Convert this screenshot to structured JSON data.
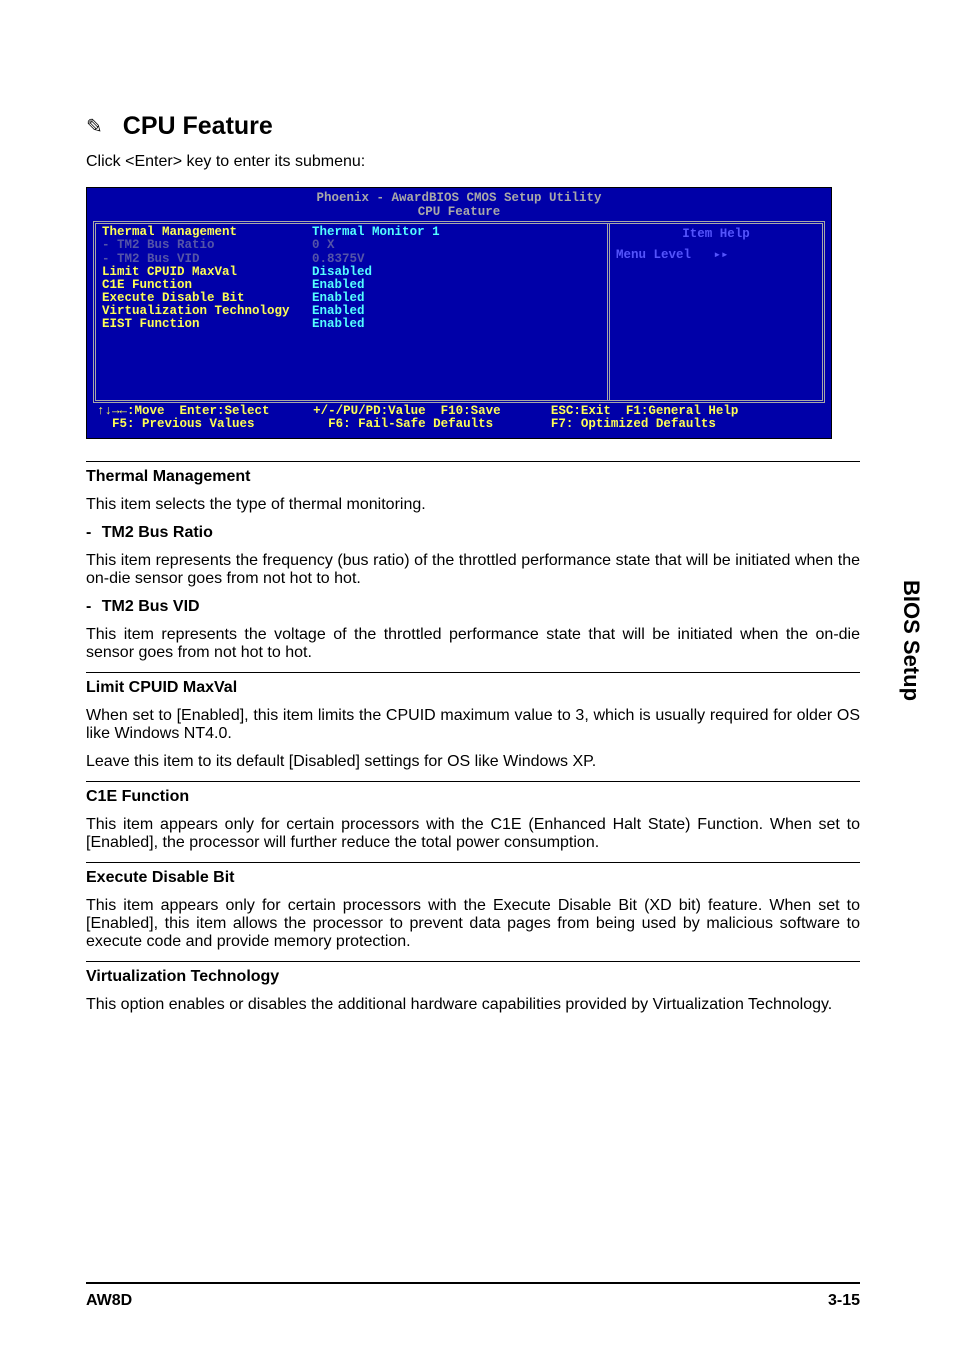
{
  "side_tab": "BIOS Setup",
  "heading": {
    "icon": "✎",
    "text": "CPU Feature"
  },
  "intro": "Click <Enter> key to enter its submenu:",
  "bios": {
    "title": "Phoenix - AwardBIOS CMOS Setup Utility",
    "subtitle": "CPU Feature",
    "rows": [
      {
        "label": "Thermal Management",
        "value": "Thermal Monitor 1",
        "dim": false
      },
      {
        "label": "- TM2 Bus Ratio",
        "value": "0 X",
        "dim": true
      },
      {
        "label": "- TM2 Bus VID",
        "value": "0.8375V",
        "dim": true
      },
      {
        "label": "Limit CPUID MaxVal",
        "value": "Disabled",
        "dim": false
      },
      {
        "label": "C1E Function",
        "value": "Enabled",
        "dim": false
      },
      {
        "label": "Execute Disable Bit",
        "value": "Enabled",
        "dim": false
      },
      {
        "label": "Virtualization Technology",
        "value": "Enabled",
        "dim": false
      },
      {
        "label": "EIST Function",
        "value": "Enabled",
        "dim": false
      }
    ],
    "help_title": "Item Help",
    "menu_level_label": "Menu Level",
    "menu_level_arrows": "▸▸",
    "footer": {
      "col1_line1": "↑↓→←:Move  Enter:Select",
      "col1_line2": "  F5: Previous Values",
      "col2_line1": "+/-/PU/PD:Value  F10:Save",
      "col2_line2": "  F6: Fail-Safe Defaults",
      "col3_line1": "ESC:Exit  F1:General Help",
      "col3_line2": "F7: Optimized Defaults"
    }
  },
  "sections": [
    {
      "title": "Thermal Management",
      "paragraphs": [
        "This item selects the type of thermal monitoring."
      ],
      "subs": [
        {
          "prefix": "-",
          "title": "TM2 Bus Ratio",
          "paragraphs": [
            "This item represents the frequency (bus ratio) of the throttled performance state that will be initiated when the on-die sensor goes from not hot to hot."
          ]
        },
        {
          "prefix": "-",
          "title": "TM2 Bus VID",
          "paragraphs": [
            "This item represents the voltage of the throttled performance state that will be initiated when the on-die sensor goes from not hot to hot."
          ]
        }
      ]
    },
    {
      "title": "Limit CPUID MaxVal",
      "paragraphs": [
        "When set to [Enabled], this item limits the CPUID maximum value to 3, which is usually required for older OS like Windows NT4.0.",
        "Leave this item to its default [Disabled] settings for OS like Windows XP."
      ],
      "subs": []
    },
    {
      "title": "C1E Function",
      "paragraphs": [
        "This item appears only for certain processors with the C1E (Enhanced Halt State) Function. When set to [Enabled], the processor will further reduce the total power consumption."
      ],
      "subs": []
    },
    {
      "title": "Execute Disable Bit",
      "paragraphs": [
        "This item appears only for certain processors with the Execute Disable Bit (XD bit) feature. When set to [Enabled], this item allows the processor to prevent data pages from being used by malicious software to execute code and provide memory protection."
      ],
      "subs": []
    },
    {
      "title": "Virtualization Technology",
      "paragraphs": [
        "This option enables or disables the additional hardware capabilities provided by Virtualization Technology."
      ],
      "subs": []
    }
  ],
  "footer": {
    "left": "AW8D",
    "right": "3-15"
  }
}
